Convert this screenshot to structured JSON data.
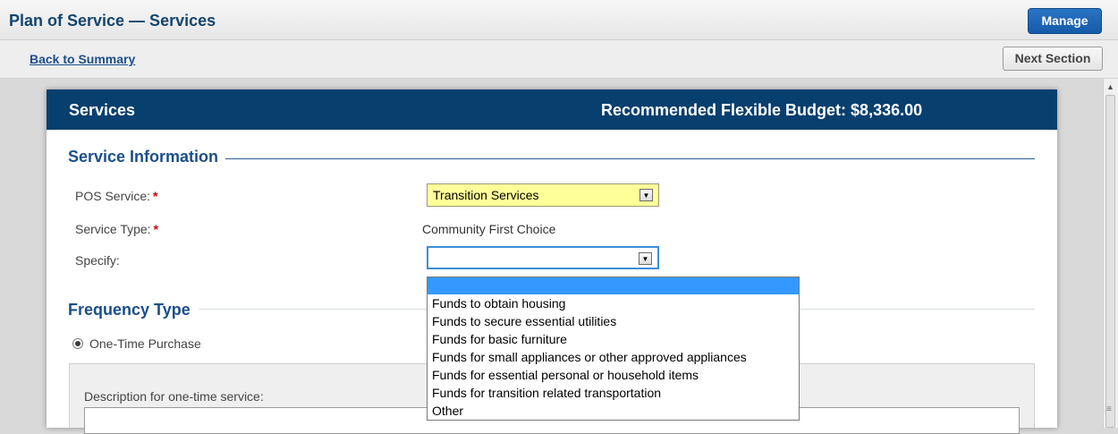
{
  "header": {
    "title": "Plan of Service — Services",
    "manage_label": "Manage"
  },
  "subnav": {
    "back_label": "Back to Summary",
    "next_label": "Next Section"
  },
  "panel": {
    "title": "Services",
    "budget": "Recommended Flexible Budget: $8,336.00"
  },
  "service_info": {
    "heading": "Service Information",
    "pos_label": "POS Service:",
    "pos_value": "Transition Services",
    "type_label": "Service Type:",
    "type_value": "Community First Choice",
    "specify_label": "Specify:",
    "specify_value": "",
    "required_mark": "*"
  },
  "frequency": {
    "heading": "Frequency Type",
    "option_label": "One-Time Purchase",
    "description_label": "Description for one-time service:",
    "description_value": ""
  },
  "specify_options": [
    "",
    "Funds to obtain housing",
    "Funds to secure essential utilities",
    "Funds for basic furniture",
    "Funds for small appliances or other approved appliances",
    "Funds for essential personal or household items",
    "Funds for transition related transportation",
    "Other"
  ],
  "colors": {
    "header_blue": "#073f6e",
    "accent_blue": "#1b4f8a",
    "required_red": "#cc0000",
    "highlight_yellow": "#ffff99",
    "selection_blue": "#3399ff"
  }
}
